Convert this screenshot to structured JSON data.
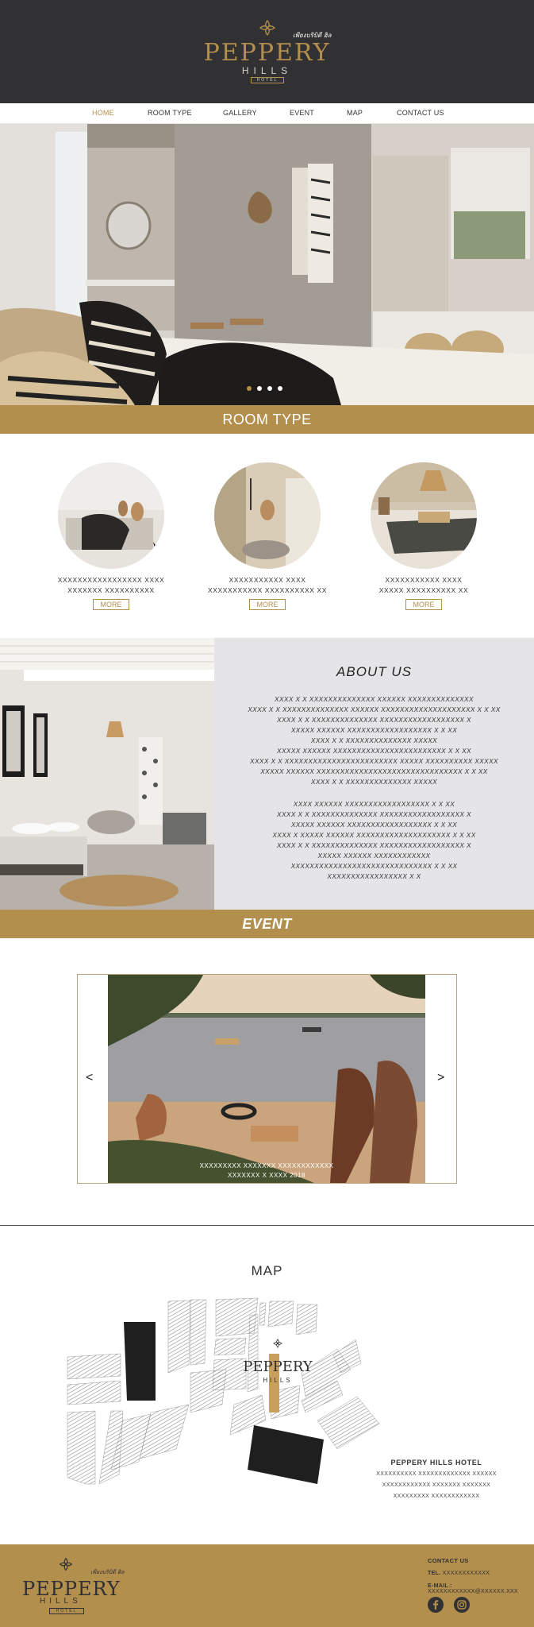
{
  "header": {
    "brand_script": "เพียงบริบิดี ฮิล",
    "brand_main": "PEPPERY",
    "brand_sub": "HILLS",
    "brand_tag": "HOTEL",
    "colors": {
      "background": "#313032",
      "accent": "#b38f4e"
    }
  },
  "nav": {
    "items": [
      {
        "label": "HOME",
        "active": true
      },
      {
        "label": "ROOM TYPE",
        "active": false
      },
      {
        "label": "GALLERY",
        "active": false
      },
      {
        "label": "EVENT",
        "active": false
      },
      {
        "label": "MAP",
        "active": false
      },
      {
        "label": "CONTACT US",
        "active": false
      }
    ]
  },
  "hero": {
    "slide_count": 4,
    "active_slide": 1
  },
  "room_type": {
    "title": "ROOM TYPE",
    "rooms": [
      {
        "desc_line1": "XXXXXXXXXXXXXXXXX XXXX",
        "desc_line2": "XXXXXXX XXXXXXXXXX",
        "button": "MORE"
      },
      {
        "desc_line1": "XXXXXXXXXXX XXXX",
        "desc_line2": "XXXXXXXXXXX XXXXXXXXXX XX",
        "button": "MORE"
      },
      {
        "desc_line1": "XXXXXXXXXXX XXXX",
        "desc_line2": "XXXXX XXXXXXXXXX XX",
        "button": "MORE"
      }
    ]
  },
  "about": {
    "title": "ABOUT US",
    "paragraph1": [
      "XXXX X X XXXXXXXXXXXXXX XXXXXX XXXXXXXXXXXXXX",
      "XXXX X X XXXXXXXXXXXXXX XXXXXX XXXXXXXXXXXXXXXXXXXX X X XX",
      "XXXX X X XXXXXXXXXXXXXX XXXXXXXXXXXXXXXXXX X",
      "XXXXX XXXXXX XXXXXXXXXXXXXXXXXX X X XX",
      "XXXX X X XXXXXXXXXXXXXX XXXXX",
      "XXXXX XXXXXX XXXXXXXXXXXXXXXXXXXXXXXX X X XX",
      "XXXX X X XXXXXXXXXXXXXXXXXXXXXXXX XXXXX XXXXXXXXXX XXXXX",
      "XXXXX XXXXXX XXXXXXXXXXXXXXXXXXXXXXXXXXXXXXX X X XX",
      "XXXX X X XXXXXXXXXXXXXX XXXXX"
    ],
    "paragraph2": [
      "XXXX XXXXXX XXXXXXXXXXXXXXXXXX X X XX",
      "XXXX X X XXXXXXXXXXXXXX XXXXXXXXXXXXXXXXXX X",
      "XXXXX XXXXXX XXXXXXXXXXXXXXXXXX X X XX",
      "XXXX X XXXXX XXXXXX XXXXXXXXXXXXXXXXXXXX X X XX",
      "XXXX X X XXXXXXXXXXXXXX XXXXXXXXXXXXXXXXXX X",
      "XXXXX XXXXXX XXXXXXXXXXXX",
      "XXXXXXXXXXXXXXXXXXXXXXXXXXXXXX X X XX",
      "XXXXXXXXXXXXXXXXX X X"
    ]
  },
  "event": {
    "title": "EVENT",
    "caption_line1": "XXXXXXXXX XXXXXXX XXXXXXXXXXXX",
    "caption_line2": "XXXXXXX X XXXX 2018",
    "prev": "<",
    "next": ">"
  },
  "map": {
    "title": "MAP",
    "hotel_name": "PEPPERY HILLS HOTEL",
    "address_lines": [
      "XXXXXXXXXX XXXXXXXXXXXXX XXXXXX",
      "XXXXXXXXXXXX XXXXXXX XXXXXXX",
      "XXXXXXXXX XXXXXXXXXXXX"
    ],
    "marker_main": "PEPPERY",
    "marker_sub": "HILLS"
  },
  "footer": {
    "brand_script": "เพียงบริบิดี ฮิล",
    "brand_main": "PEPPERY",
    "brand_sub": "HILLS",
    "brand_tag": "HOTEL",
    "contact_title": "CONTACT US",
    "tel_label": "TEL.",
    "tel_value": "XXXXXXXXXXXX",
    "email_label": "E-MAIL :",
    "email_value": "XXXXXXXXXXXX@XXXXXX.XXX",
    "social": [
      "facebook-icon",
      "instagram-icon"
    ]
  }
}
